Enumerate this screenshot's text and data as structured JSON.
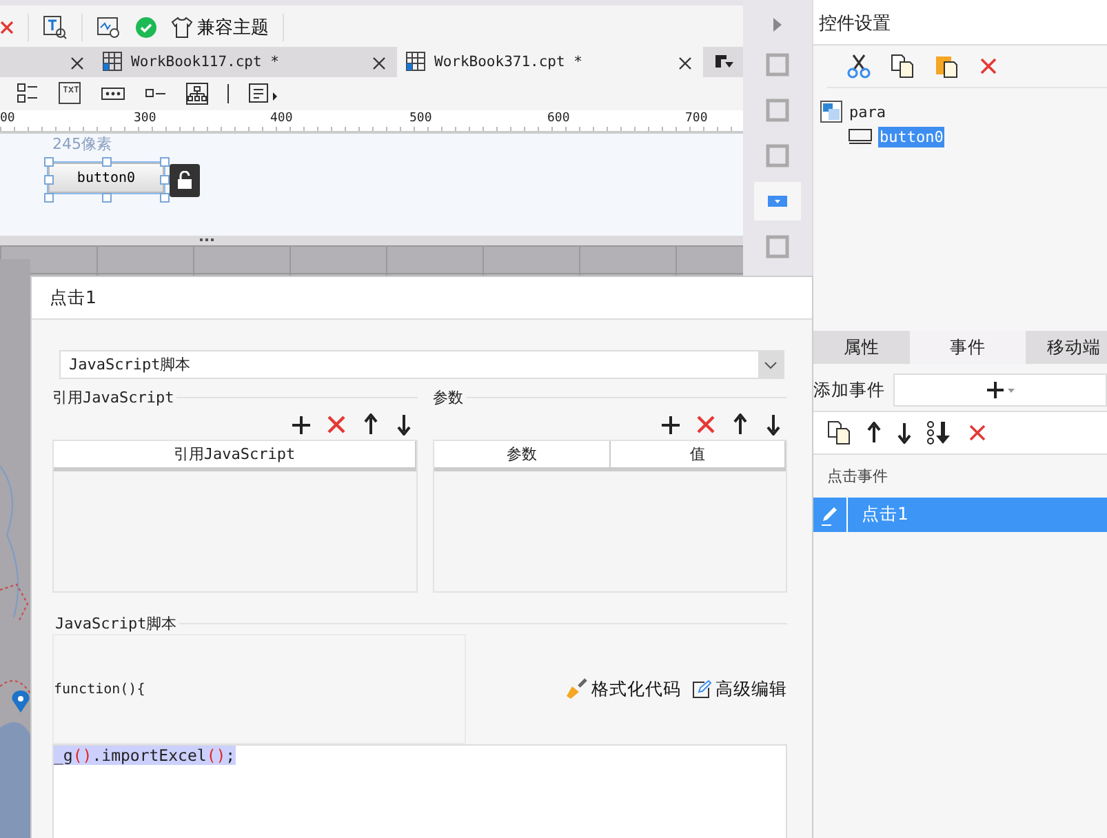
{
  "toolbar": {
    "theme_button": "兼容主题"
  },
  "tabs": [
    {
      "label": "WorkBook117.cpt *",
      "selected": false
    },
    {
      "label": "WorkBook371.cpt *",
      "selected": true
    }
  ],
  "ruler": {
    "ticks": [
      "00",
      "300",
      "400",
      "500",
      "600",
      "700"
    ]
  },
  "canvas": {
    "size_label": "245像素",
    "widget": {
      "label": "button0",
      "selected": true
    }
  },
  "side_strip": {
    "items": [
      {
        "selected": false
      },
      {
        "selected": false
      },
      {
        "selected": false
      },
      {
        "selected": true
      },
      {
        "selected": false
      }
    ]
  },
  "widget_settings": {
    "title": "控件设置",
    "tree": {
      "label": "para",
      "children": [
        {
          "label": "button0",
          "selected": true
        }
      ]
    }
  },
  "properties": {
    "tabs": [
      {
        "label": "属性",
        "selected": false
      },
      {
        "label": "事件",
        "selected": true
      },
      {
        "label": "移动端",
        "selected": false
      }
    ],
    "add_event_label": "添加事件",
    "group_label": "点击事件",
    "events": [
      {
        "label": "点击1",
        "selected": true
      }
    ]
  },
  "dialog": {
    "title": "点击1",
    "type_select": "JavaScript脚本",
    "ref_section": {
      "title": "引用JavaScript",
      "columns": [
        "引用JavaScript"
      ]
    },
    "param_section": {
      "title": "参数",
      "columns": [
        "参数",
        "值"
      ]
    },
    "script_section": {
      "title": "JavaScript脚本",
      "header": "function(){",
      "format_button": "格式化代码",
      "advanced_button": "高级编辑",
      "code": [
        {
          "text": "_g",
          "kind": "plain"
        },
        {
          "text": "()",
          "kind": "paren"
        },
        {
          "text": ".importExcel",
          "kind": "plain"
        },
        {
          "text": "()",
          "kind": "paren"
        },
        {
          "text": ";",
          "kind": "plain"
        }
      ]
    }
  }
}
